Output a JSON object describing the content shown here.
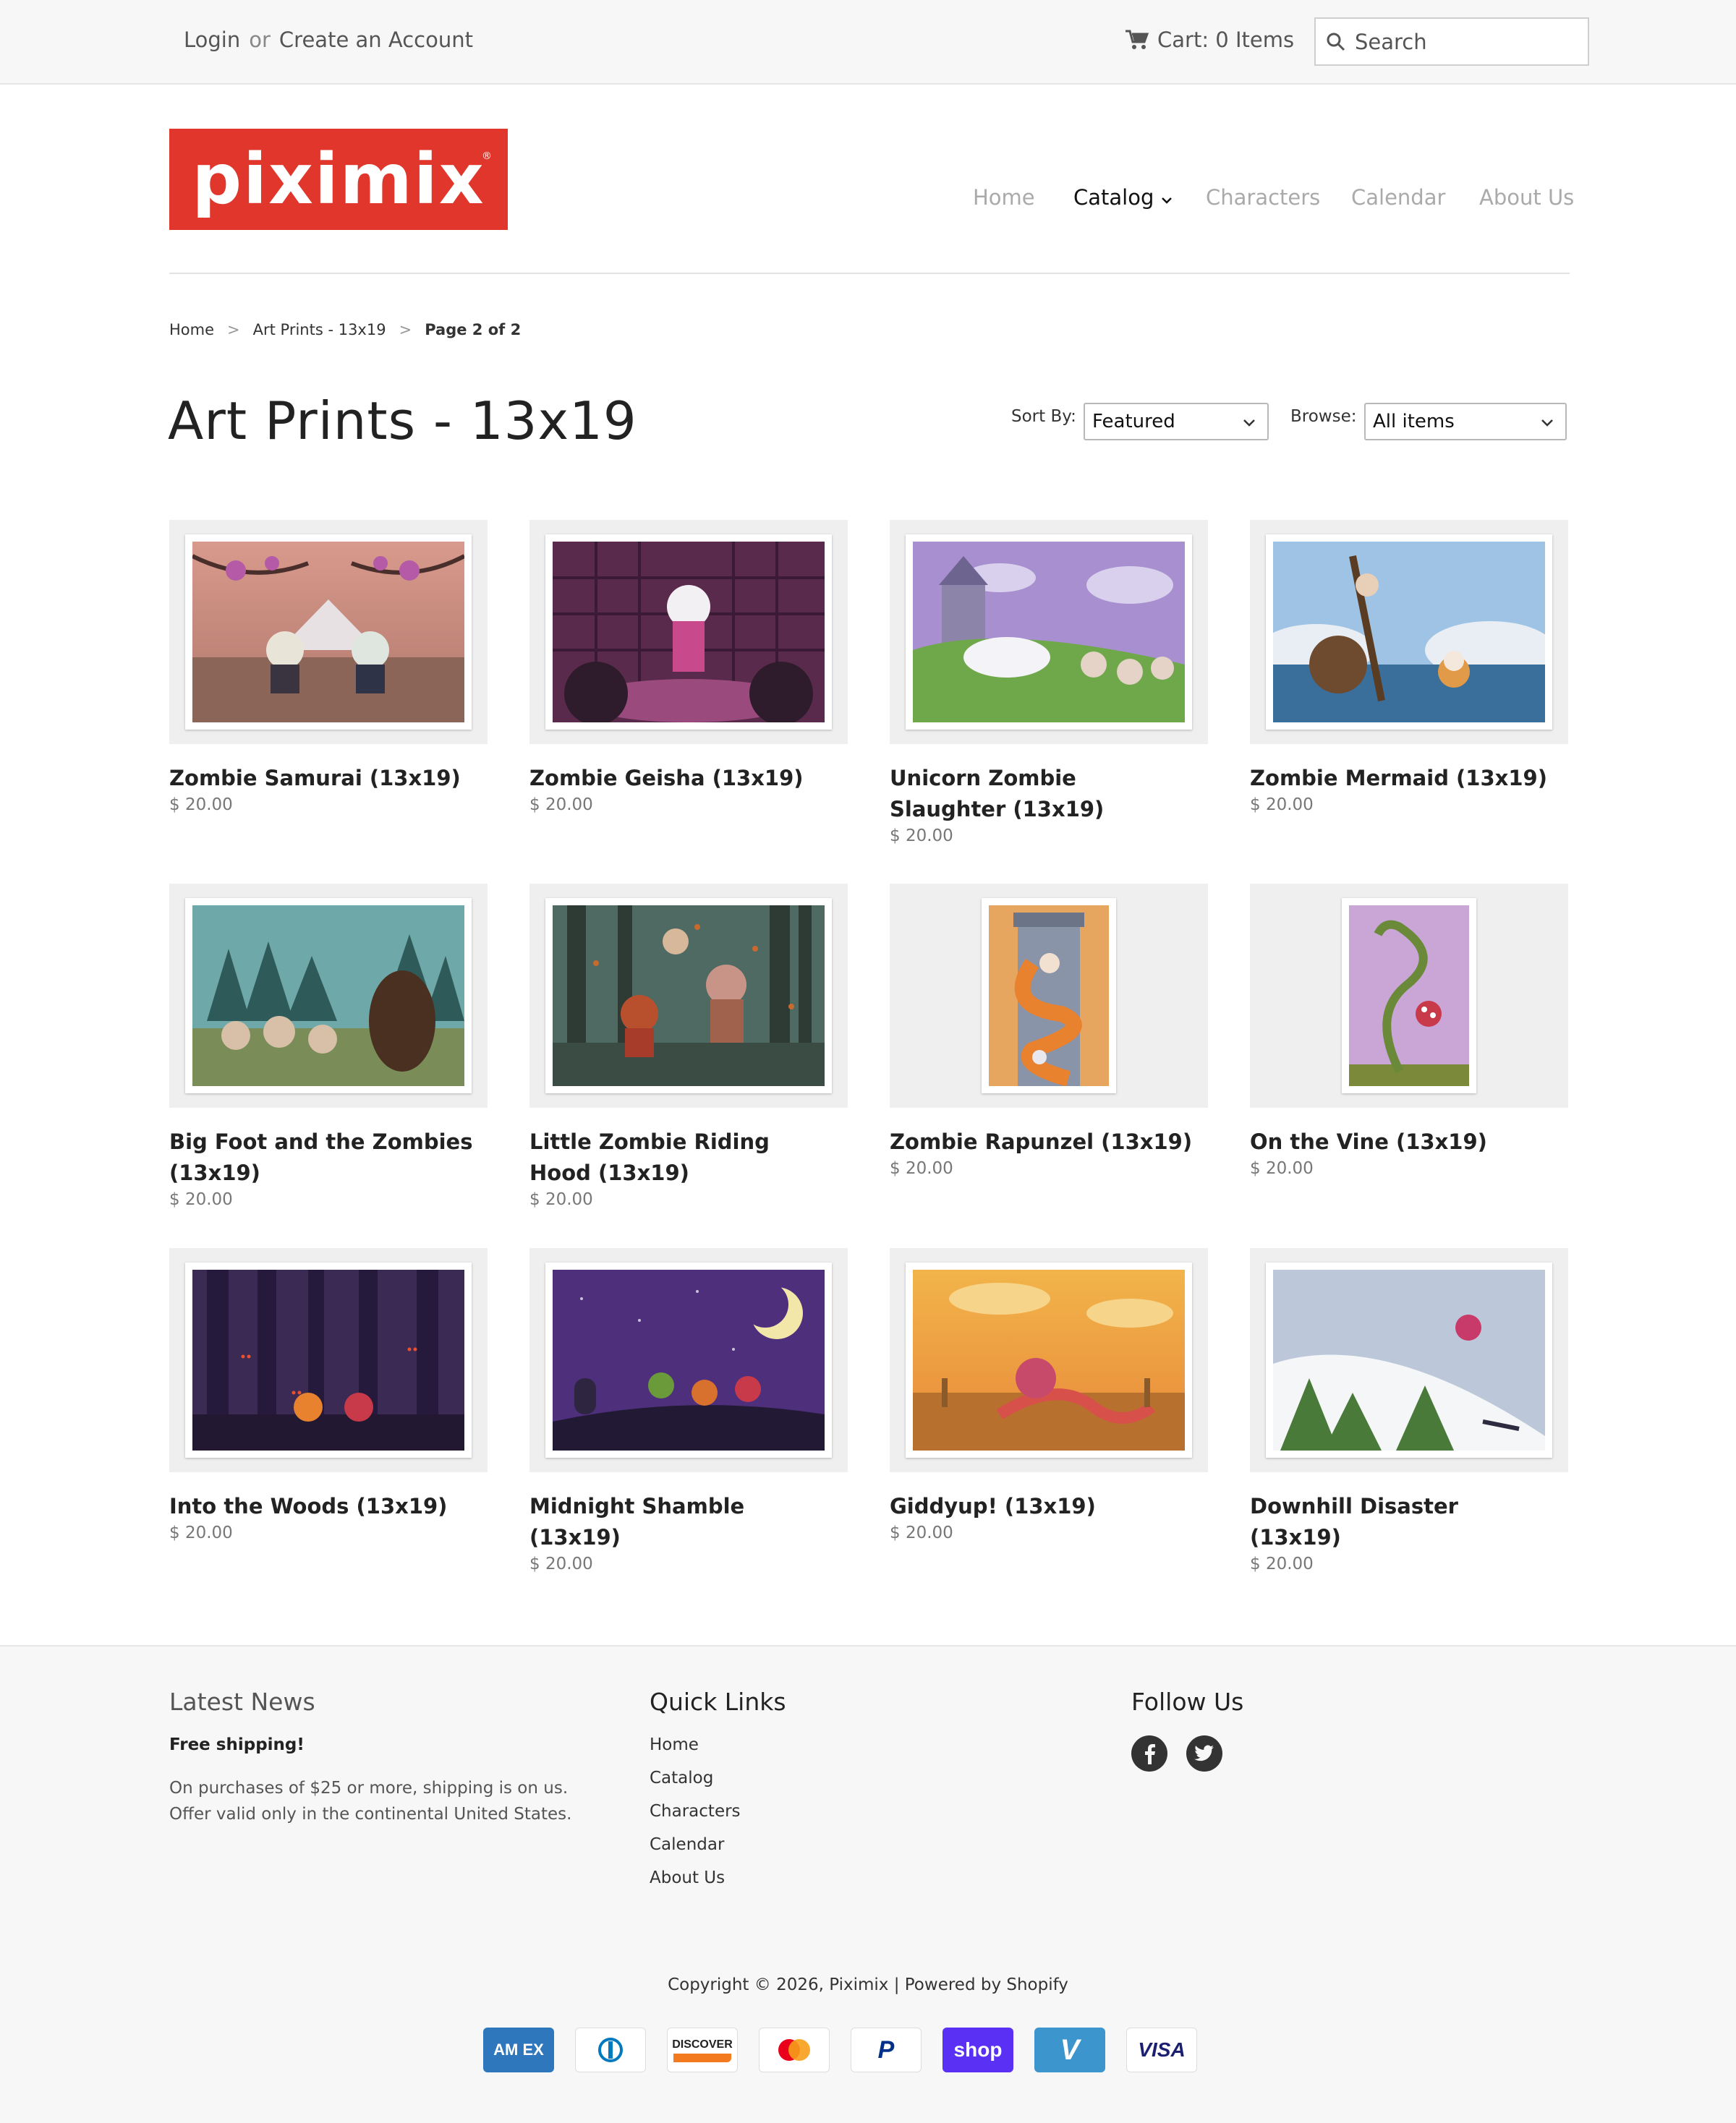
{
  "topbar": {
    "login": "Login",
    "or": "or",
    "create_account": "Create an Account",
    "cart": "Cart: 0 Items",
    "search_placeholder": "Search"
  },
  "brand": {
    "logo_text": "piximix",
    "logo_color": "#e0362c"
  },
  "nav": {
    "items": [
      {
        "label": "Home"
      },
      {
        "label": "Catalog"
      },
      {
        "label": "Characters"
      },
      {
        "label": "Calendar"
      },
      {
        "label": "About Us"
      }
    ],
    "active": "Catalog"
  },
  "breadcrumb": {
    "home": "Home",
    "category": "Art Prints - 13x19",
    "current": "Page 2 of 2",
    "separator": ">"
  },
  "page": {
    "title": "Art Prints - 13x19",
    "sort_label": "Sort By:",
    "sort_value": "Featured",
    "browse_label": "Browse:",
    "browse_value": "All items"
  },
  "products": [
    {
      "name": "Zombie Samurai (13x19)",
      "price": "$ 20.00",
      "art": "samurai",
      "orientation": "landscape"
    },
    {
      "name": "Zombie Geisha (13x19)",
      "price": "$ 20.00",
      "art": "geisha",
      "orientation": "landscape"
    },
    {
      "name": "Unicorn Zombie Slaughter (13x19)",
      "price": "$ 20.00",
      "art": "unicorn",
      "orientation": "landscape"
    },
    {
      "name": "Zombie Mermaid (13x19)",
      "price": "$ 20.00",
      "art": "mermaid",
      "orientation": "landscape"
    },
    {
      "name": "Big Foot and the Zombies (13x19)",
      "price": "$ 20.00",
      "art": "bigfoot",
      "orientation": "landscape"
    },
    {
      "name": "Little Zombie Riding Hood (13x19)",
      "price": "$ 20.00",
      "art": "ridinghood",
      "orientation": "landscape"
    },
    {
      "name": "Zombie Rapunzel (13x19)",
      "price": "$ 20.00",
      "art": "rapunzel",
      "orientation": "portrait"
    },
    {
      "name": "On the Vine (13x19)",
      "price": "$ 20.00",
      "art": "vine",
      "orientation": "portrait"
    },
    {
      "name": "Into the Woods (13x19)",
      "price": "$ 20.00",
      "art": "woods",
      "orientation": "landscape"
    },
    {
      "name": "Midnight Shamble (13x19)",
      "price": "$ 20.00",
      "art": "midnight",
      "orientation": "landscape"
    },
    {
      "name": "Giddyup! (13x19)",
      "price": "$ 20.00",
      "art": "giddyup",
      "orientation": "landscape"
    },
    {
      "name": "Downhill Disaster (13x19)",
      "price": "$ 20.00",
      "art": "downhill",
      "orientation": "landscape"
    }
  ],
  "footer": {
    "news_title": "Latest News",
    "news_headline": "Free shipping!",
    "news_body": "On purchases of $25 or more, shipping is on us. Offer valid only in the continental United States.",
    "links_title": "Quick Links",
    "links": [
      "Home",
      "Catalog",
      "Characters",
      "Calendar",
      "About Us"
    ],
    "follow_title": "Follow Us",
    "social": [
      "facebook-icon",
      "twitter-icon"
    ],
    "copyright": "Copyright © 2026, Piximix | Powered by Shopify",
    "payments": [
      {
        "name": "American Express",
        "text": "AM EX",
        "bg": "#2e77bc",
        "fg": "#ffffff"
      },
      {
        "name": "Diners Club",
        "text": "",
        "bg": "#ffffff",
        "fg": "#0079be"
      },
      {
        "name": "Discover",
        "text": "DISCOVER",
        "bg": "#ffffff",
        "fg": "#222222"
      },
      {
        "name": "Mastercard",
        "text": "",
        "bg": "#ffffff",
        "fg": "#eb001b"
      },
      {
        "name": "PayPal",
        "text": "P",
        "bg": "#ffffff",
        "fg": "#003087"
      },
      {
        "name": "Shop Pay",
        "text": "shop",
        "bg": "#5a31f4",
        "fg": "#ffffff"
      },
      {
        "name": "Venmo",
        "text": "V",
        "bg": "#3d95ce",
        "fg": "#ffffff"
      },
      {
        "name": "Visa",
        "text": "VISA",
        "bg": "#ffffff",
        "fg": "#1a1f71"
      }
    ]
  }
}
